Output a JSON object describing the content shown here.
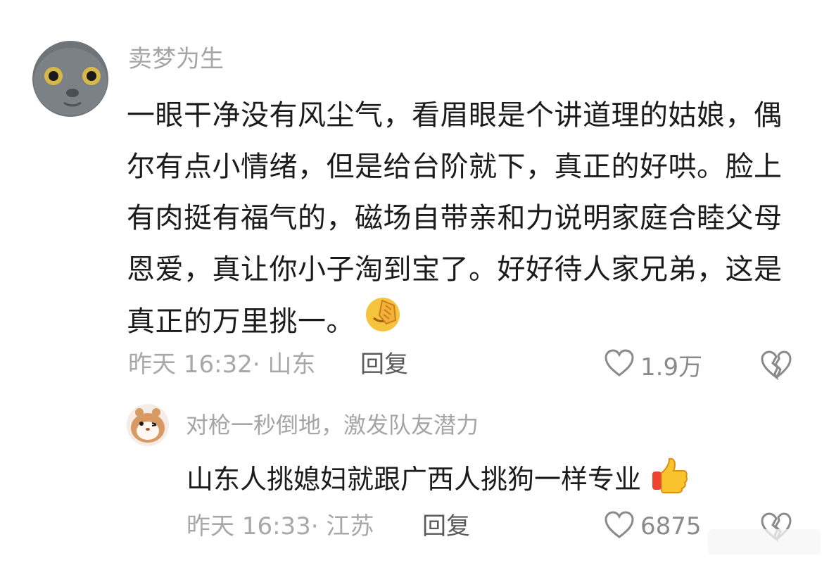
{
  "comments": [
    {
      "avatar_icon": "gray-cat-avatar",
      "username": "卖梦为生",
      "text": "一眼干净没有风尘气，看眉眼是个讲道理的姑娘，偶尔有点小情绪，但是给台阶就下，真正的好哄。脸上有肉挺有福气的，磁场自带亲和力说明家庭合睦父母恩爱，真让你小子淘到宝了。好好待人家兄弟，这是真正的万里挑一。",
      "emoji_icon": "facepalm-emoji",
      "time_location": "昨天 16:32· 山东",
      "reply_label": "回复",
      "likes": "1.9万",
      "like_icon": "heart-outline-icon",
      "dislike_icon": "broken-heart-icon"
    },
    {
      "avatar_icon": "cartoon-hamster-avatar",
      "username": "对枪一秒倒地，激发队友潜力",
      "text": "山东人挑媳妇就跟广西人挑狗一样专业",
      "emoji_icon": "thumbs-up-emoji",
      "time_location": "昨天 16:33· 江苏",
      "reply_label": "回复",
      "likes": "6875",
      "like_icon": "heart-outline-icon",
      "dislike_icon": "broken-heart-icon"
    }
  ],
  "colors": {
    "meta_text": "#a8a8a8",
    "username": "#a5a5a5",
    "body_text": "#1b1b1b"
  }
}
